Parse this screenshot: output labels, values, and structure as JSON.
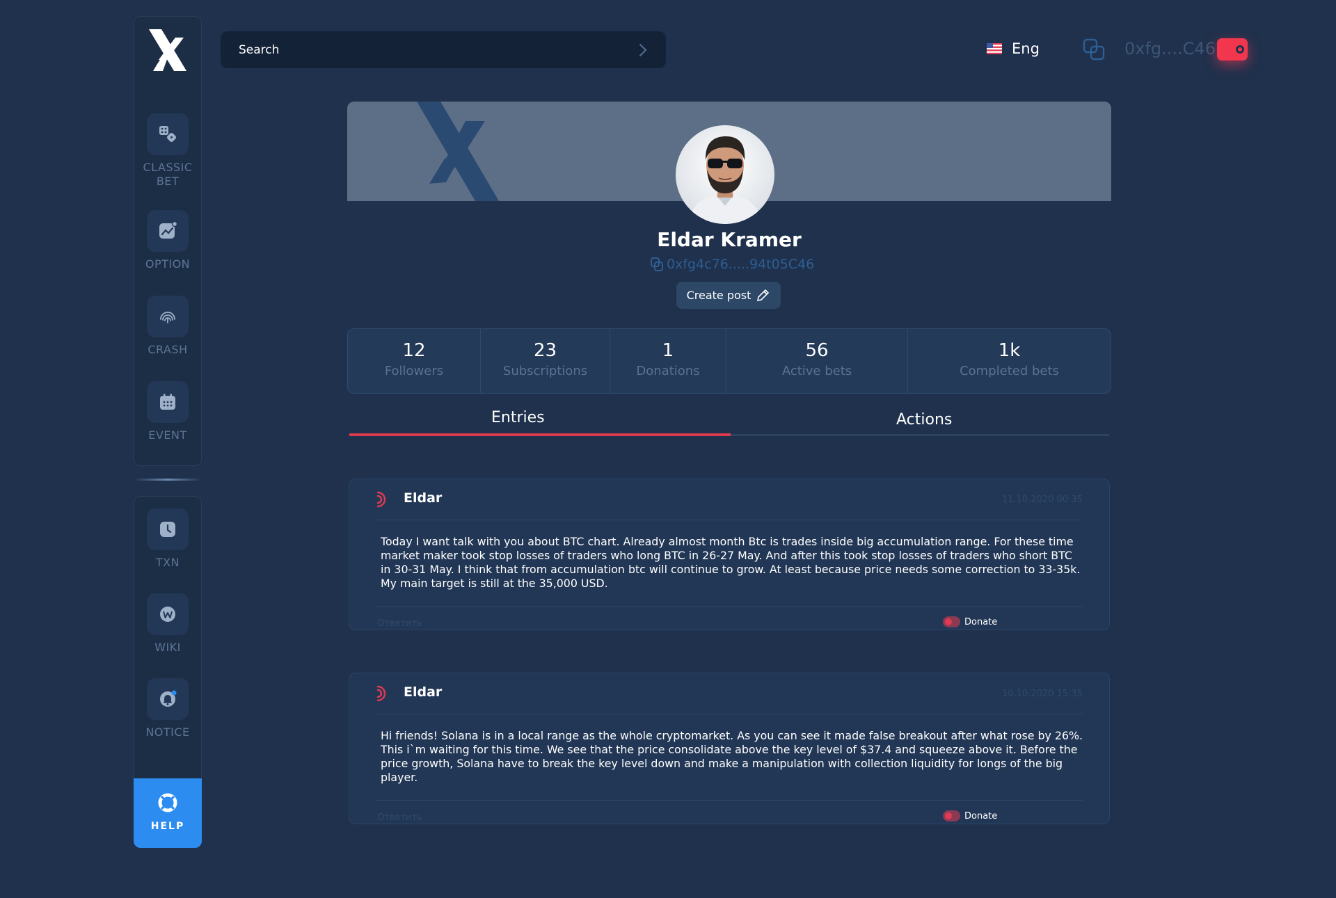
{
  "sidebar": {
    "items": [
      {
        "label": "CLASSIC BET",
        "icon": "dice-icon"
      },
      {
        "label": "OPTION",
        "icon": "chart-icon"
      },
      {
        "label": "CRASH",
        "icon": "fingerprint-icon"
      },
      {
        "label": "EVENT",
        "icon": "calendar-icon"
      },
      {
        "label": "TXN",
        "icon": "clock-icon"
      },
      {
        "label": "WIKI",
        "icon": "wiki-icon"
      },
      {
        "label": "NOTICE",
        "icon": "bell-icon"
      }
    ],
    "help": {
      "label": "HELP",
      "icon": "lifebuoy-icon"
    }
  },
  "header": {
    "search": {
      "placeholder": "Search"
    },
    "language": "Eng",
    "wallet_address": "0xfg....C46"
  },
  "profile": {
    "name": "Eldar Kramer",
    "address": "0xfg4c76.....94t05C46",
    "create_post_label": "Create post",
    "stats": [
      {
        "value": "12",
        "label": "Followers"
      },
      {
        "value": "23",
        "label": "Subscriptions"
      },
      {
        "value": "1",
        "label": "Donations"
      },
      {
        "value": "56",
        "label": "Active bets"
      },
      {
        "value": "1k",
        "label": "Completed bets"
      }
    ]
  },
  "tabs": [
    {
      "label": "Entries",
      "active": true
    },
    {
      "label": "Actions",
      "active": false
    }
  ],
  "posts": [
    {
      "author": "Eldar",
      "date": "11.10.2020  00:35",
      "text": "Today I want talk with you about BTC chart. Already almost month Btc is trades inside big accumulation range. For these time market maker took stop losses of traders who long BTC in 26-27 May. And after this took stop losses of traders who short BTC in 30-31 May. I think that from accumulation btc will continue to grow. At least because price needs some correction to 33-35k. My main target is still at the 35,000 USD.",
      "reply_label": "Ответить",
      "donate_label": "Donate"
    },
    {
      "author": "Eldar",
      "date": "10.10.2020  15:35",
      "text": "Hi friends! Solana is in a local range as the whole cryptomarket. As you can see it made false breakout after what rose by 26%. This i`m waiting for this time. We see that the price consolidate above the key level of $37.4 and squeeze above it. Before the price growth, Solana have to break the key level down and make a manipulation with collection liquidity for longs of the big player.",
      "reply_label": "Ответить",
      "donate_label": "Donate"
    }
  ],
  "colors": {
    "background": "#1f314c",
    "accent_red": "#f2364e",
    "help_blue": "#2d8cf0",
    "address_blue": "#2e5f94"
  }
}
